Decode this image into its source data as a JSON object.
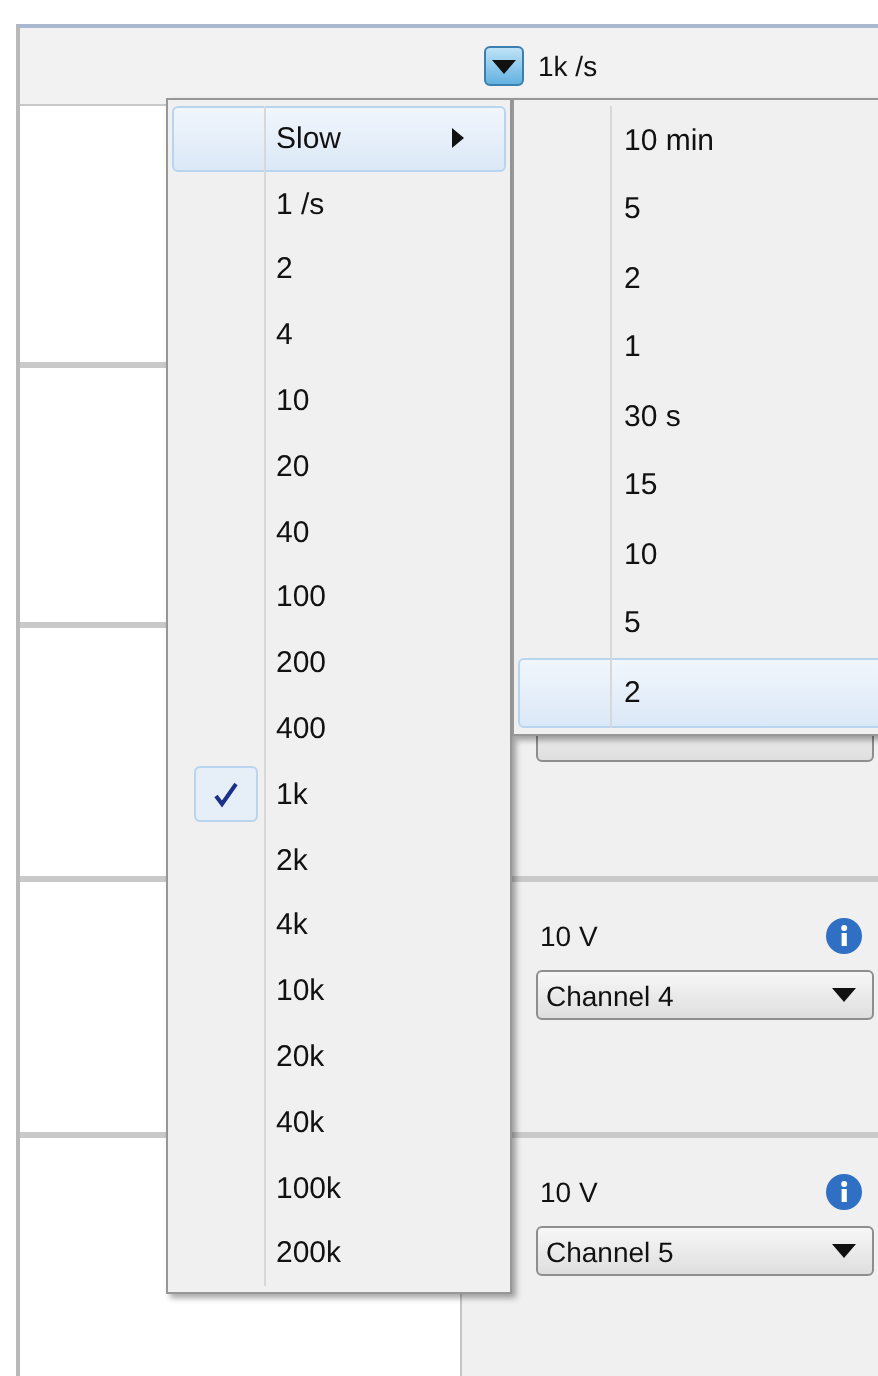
{
  "toolbar": {
    "rate": "1k /s"
  },
  "panels": [
    {
      "kind": "blank"
    },
    {
      "kind": "blank"
    },
    {
      "kind": "covered"
    },
    {
      "kind": "channel",
      "range": "10 V",
      "channel": "Channel 4"
    },
    {
      "kind": "channel",
      "range": "10 V",
      "channel": "Channel 5"
    }
  ],
  "rate_menu": {
    "items": [
      {
        "label": "Slow",
        "kind": "submenu",
        "expanded": true,
        "checked": false
      },
      {
        "label": "1 /s",
        "kind": "item",
        "expanded": false,
        "checked": false
      },
      {
        "label": "2",
        "kind": "item",
        "expanded": false,
        "checked": false
      },
      {
        "label": "4",
        "kind": "item",
        "expanded": false,
        "checked": false
      },
      {
        "label": "10",
        "kind": "item",
        "expanded": false,
        "checked": false
      },
      {
        "label": "20",
        "kind": "item",
        "expanded": false,
        "checked": false
      },
      {
        "label": "40",
        "kind": "item",
        "expanded": false,
        "checked": false
      },
      {
        "label": "100",
        "kind": "item",
        "expanded": false,
        "checked": false
      },
      {
        "label": "200",
        "kind": "item",
        "expanded": false,
        "checked": false
      },
      {
        "label": "400",
        "kind": "item",
        "expanded": false,
        "checked": false
      },
      {
        "label": "1k",
        "kind": "item",
        "expanded": false,
        "checked": true
      },
      {
        "label": "2k",
        "kind": "item",
        "expanded": false,
        "checked": false
      },
      {
        "label": "4k",
        "kind": "item",
        "expanded": false,
        "checked": false
      },
      {
        "label": "10k",
        "kind": "item",
        "expanded": false,
        "checked": false
      },
      {
        "label": "20k",
        "kind": "item",
        "expanded": false,
        "checked": false
      },
      {
        "label": "40k",
        "kind": "item",
        "expanded": false,
        "checked": false
      },
      {
        "label": "100k",
        "kind": "item",
        "expanded": false,
        "checked": false
      },
      {
        "label": "200k",
        "kind": "item",
        "expanded": false,
        "checked": false
      }
    ]
  },
  "slow_submenu": {
    "items": [
      {
        "label": "10 min",
        "selected": false
      },
      {
        "label": "5",
        "selected": false
      },
      {
        "label": "2",
        "selected": false
      },
      {
        "label": "1",
        "selected": false
      },
      {
        "label": "30 s",
        "selected": false
      },
      {
        "label": "15",
        "selected": false
      },
      {
        "label": "10",
        "selected": false
      },
      {
        "label": "5",
        "selected": false
      },
      {
        "label": "2",
        "selected": true
      }
    ]
  }
}
